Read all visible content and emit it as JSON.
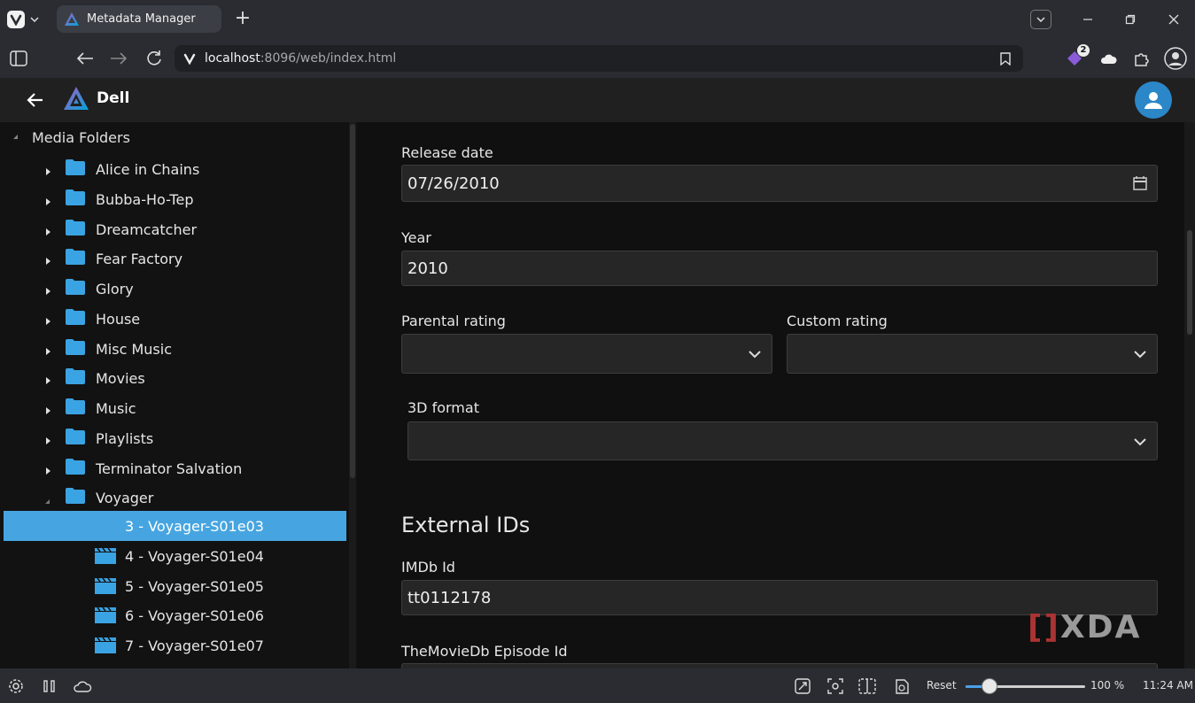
{
  "browser": {
    "tab_title": "Metadata Manager",
    "url_host": "localhost",
    "url_rest": ":8096/web/index.html",
    "extension_badge": "2"
  },
  "app": {
    "name": "Dell"
  },
  "tree": {
    "root_label": "Media Folders",
    "folders": [
      "Alice in Chains",
      "Bubba-Ho-Tep",
      "Dreamcatcher",
      "Fear Factory",
      "Glory",
      "House",
      "Misc Music",
      "Movies",
      "Music",
      "Playlists",
      "Terminator Salvation",
      "Voyager"
    ],
    "episodes": [
      "3 - Voyager-S01e03",
      "4 - Voyager-S01e04",
      "5 - Voyager-S01e05",
      "6 - Voyager-S01e06",
      "7 - Voyager-S01e07"
    ]
  },
  "form": {
    "release_date_label": "Release date",
    "release_date_value": "07/26/2010",
    "year_label": "Year",
    "year_value": "2010",
    "parental_rating_label": "Parental rating",
    "parental_rating_value": "",
    "custom_rating_label": "Custom rating",
    "custom_rating_value": "",
    "format3d_label": "3D format",
    "format3d_value": "",
    "external_ids_title": "External IDs",
    "imdb_label": "IMDb Id",
    "imdb_value": "tt0112178",
    "tmdb_episode_label": "TheMovieDb Episode Id"
  },
  "watermark": {
    "bracket": "[]",
    "text": "XDA"
  },
  "statusbar": {
    "reset_label": "Reset",
    "zoom_value": "100 %",
    "zoom_fraction": 0.2,
    "clock": "11:24 AM"
  },
  "colors": {
    "accent": "#46a5e0",
    "folder": "#3aa3e3",
    "avatar": "#2b87c7"
  }
}
